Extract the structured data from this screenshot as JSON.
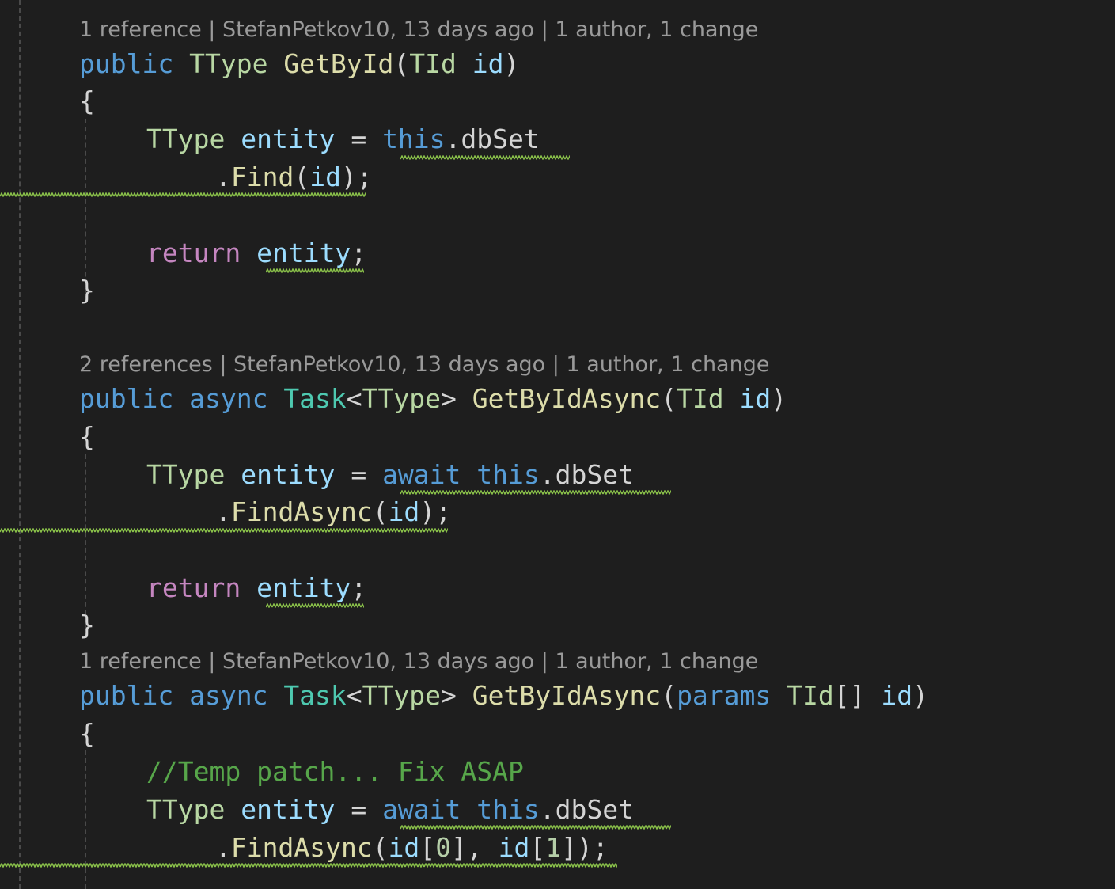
{
  "blocks": [
    {
      "codelens": "1 reference | StefanPetkov10, 13 days ago | 1 author, 1 change",
      "signature": {
        "public": "public",
        "return_type": "TType",
        "name": "GetById",
        "open": "(",
        "param_type": "TId",
        "param_name": "id",
        "close": ")"
      },
      "open_brace": "{",
      "stmt": {
        "type": "TType",
        "var": "entity",
        "eq": "=",
        "this": "this",
        "member": ".dbSet"
      },
      "call": {
        "dot": ".",
        "method": "Find",
        "open": "(",
        "arg": "id",
        "close": ");"
      },
      "ret": {
        "kw": "return",
        "var": "entity",
        "semi": ";"
      },
      "close_brace": "}"
    },
    {
      "codelens": "2 references | StefanPetkov10, 13 days ago | 1 author, 1 change",
      "signature": {
        "public": "public",
        "async": "async",
        "task": "Task",
        "lt": "<",
        "generic": "TType",
        "gt": ">",
        "name": "GetByIdAsync",
        "open": "(",
        "param_type": "TId",
        "param_name": "id",
        "close": ")"
      },
      "open_brace": "{",
      "stmt": {
        "type": "TType",
        "var": "entity",
        "eq": "=",
        "await": "await",
        "this": "this",
        "member": ".dbSet"
      },
      "call": {
        "dot": ".",
        "method": "FindAsync",
        "open": "(",
        "arg": "id",
        "close": ");"
      },
      "ret": {
        "kw": "return",
        "var": "entity",
        "semi": ";"
      },
      "close_brace": "}"
    },
    {
      "codelens": "1 reference | StefanPetkov10, 13 days ago | 1 author, 1 change",
      "signature": {
        "public": "public",
        "async": "async",
        "task": "Task",
        "lt": "<",
        "generic": "TType",
        "gt": ">",
        "name": "GetByIdAsync",
        "open": "(",
        "params_kw": "params",
        "param_type": "TId",
        "brackets": "[]",
        "param_name": "id",
        "close": ")"
      },
      "open_brace": "{",
      "comment": "//Temp patch... Fix ASAP",
      "stmt": {
        "type": "TType",
        "var": "entity",
        "eq": "=",
        "await": "await",
        "this": "this",
        "member": ".dbSet"
      },
      "call": {
        "dot": ".",
        "method": "FindAsync",
        "open": "(",
        "arg1": "id",
        "lb1": "[",
        "idx1": "0",
        "rb1": "],",
        "arg2": "id",
        "lb2": "[",
        "idx2": "1",
        "close": "]);"
      }
    }
  ],
  "colors": {
    "background": "#1e1e1e",
    "keyword": "#569cd6",
    "control_keyword": "#c586c0",
    "type": "#b8d7a3",
    "class": "#4ec9b0",
    "method": "#dcdcaa",
    "variable": "#9cdcfe",
    "comment": "#57a64a",
    "squiggle": "#8bc34a",
    "codelens": "#9a9a9a"
  }
}
